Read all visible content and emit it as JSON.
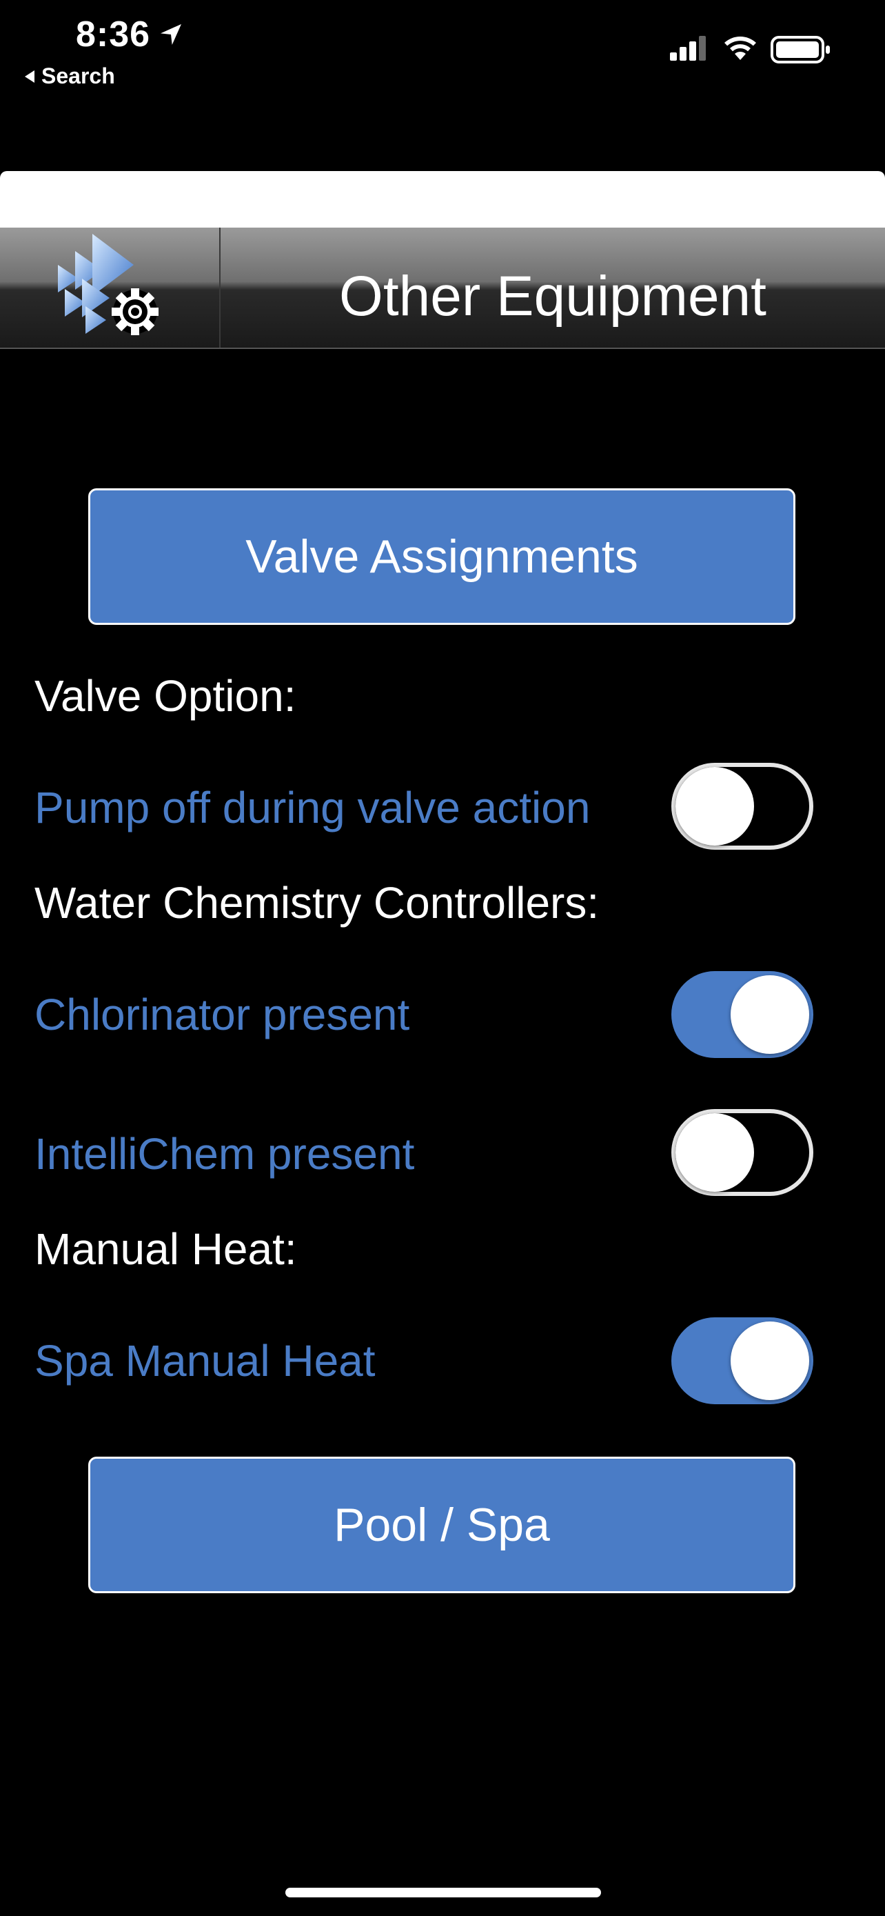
{
  "status_bar": {
    "time": "8:36",
    "back_label": "Search"
  },
  "header": {
    "title": "Other Equipment"
  },
  "main": {
    "valve_assignments_label": "Valve Assignments",
    "valve_option_label": "Valve Option:",
    "pump_off_label": "Pump off during valve action",
    "pump_off_on": false,
    "water_chemistry_label": "Water Chemistry Controllers:",
    "chlorinator_label": "Chlorinator present",
    "chlorinator_on": true,
    "intellichem_label": "IntelliChem present",
    "intellichem_on": false,
    "manual_heat_label": "Manual Heat:",
    "spa_manual_heat_label": "Spa Manual Heat",
    "spa_manual_heat_on": true,
    "pool_spa_label": "Pool / Spa"
  },
  "colors": {
    "accent": "#4a7cc6",
    "background": "#000000",
    "text": "#ffffff"
  },
  "icons": [
    "location-arrow-icon",
    "back-arrow-icon",
    "signal-icon",
    "wifi-icon",
    "battery-icon",
    "equipment-settings-logo-icon"
  ]
}
